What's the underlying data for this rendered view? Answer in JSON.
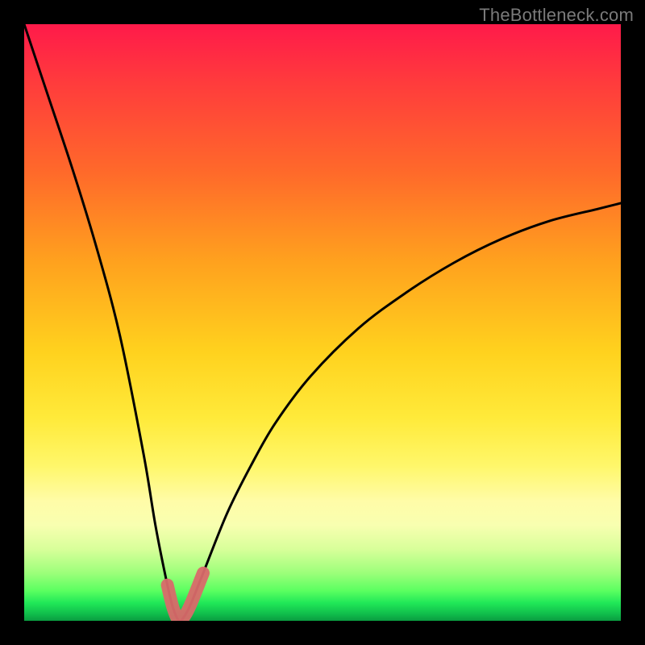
{
  "watermark": "TheBottleneck.com",
  "colors": {
    "frame": "#000000",
    "curve": "#000000",
    "highlight": "#d96a6a",
    "watermark": "#7a7a7a",
    "gradient_stops": [
      "#ff1a4a",
      "#ff3c3c",
      "#ff6a2a",
      "#ffa21e",
      "#ffd21e",
      "#ffea3a",
      "#fff76a",
      "#fffca8",
      "#f8ffb0",
      "#d8ff9a",
      "#9cff7a",
      "#5aff60",
      "#20e858",
      "#0fba4a",
      "#0a9c40"
    ]
  },
  "chart_data": {
    "type": "line",
    "title": "",
    "xlabel": "",
    "ylabel": "",
    "xlim": [
      0,
      100
    ],
    "ylim": [
      0,
      100
    ],
    "note": "V-shaped bottleneck curve; y≈0 near x≈26 (optimal), rising steeply toward 100 on the left edge and toward ~70 at x=100. Highlighted segment marks the near-zero valley roughly x∈[23,30].",
    "series": [
      {
        "name": "bottleneck-curve",
        "x": [
          0,
          4,
          8,
          12,
          16,
          20,
          22,
          24,
          25,
          26,
          27,
          28,
          30,
          34,
          38,
          42,
          48,
          56,
          64,
          72,
          80,
          88,
          96,
          100
        ],
        "y": [
          100,
          88,
          76,
          63,
          48,
          28,
          16,
          6,
          2,
          0,
          1,
          3,
          8,
          18,
          26,
          33,
          41,
          49,
          55,
          60,
          64,
          67,
          69,
          70
        ]
      }
    ],
    "highlight_range_x": [
      23,
      30
    ]
  }
}
